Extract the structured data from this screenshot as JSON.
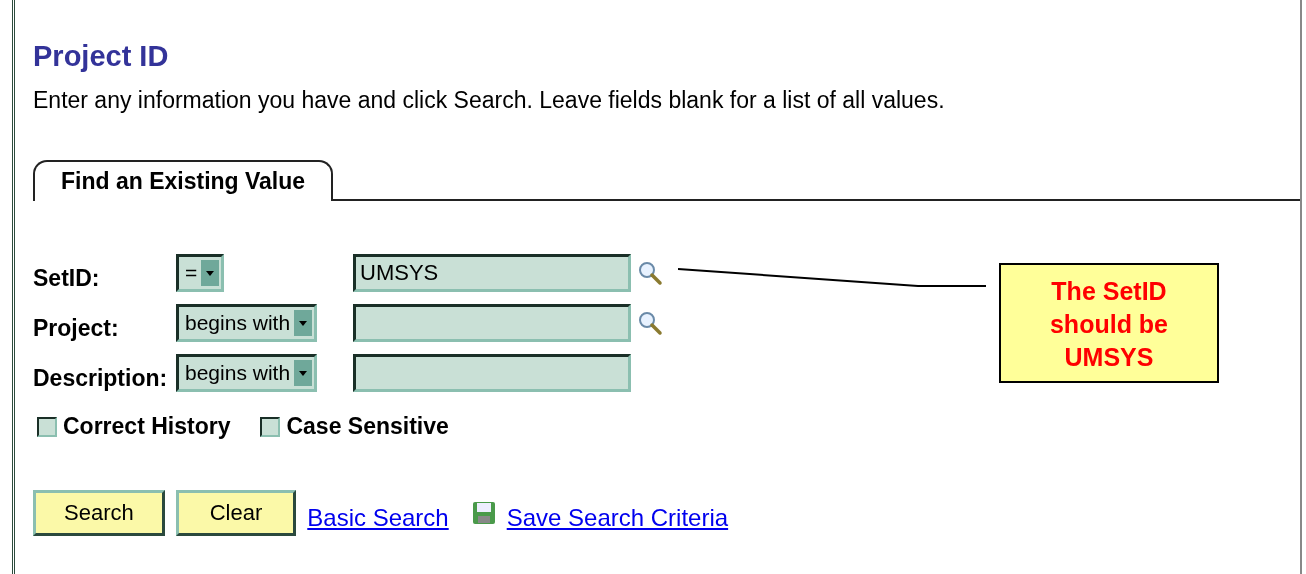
{
  "page": {
    "title": "Project ID",
    "instructions": "Enter any information you have and click Search. Leave fields blank for a list of all values."
  },
  "tabs": [
    {
      "label": "Find an Existing Value",
      "selected": true
    }
  ],
  "fields": [
    {
      "label": "SetID:",
      "operator": "=",
      "value": "UMSYS",
      "lookup": true
    },
    {
      "label": "Project:",
      "operator": "begins with",
      "lookup": true
    },
    {
      "label": "Description:",
      "operator": "begins with",
      "lookup": false
    }
  ],
  "checkboxes": [
    {
      "label": "Correct History",
      "checked": false
    },
    {
      "label": "Case Sensitive",
      "checked": false
    }
  ],
  "buttons": [
    "Search",
    "Clear"
  ],
  "links": [
    {
      "label": "Basic Search",
      "kind": "plain"
    },
    {
      "label": "Save Search Criteria",
      "kind": "saved"
    }
  ],
  "callout": {
    "text": "The SetID should be UMSYS"
  }
}
